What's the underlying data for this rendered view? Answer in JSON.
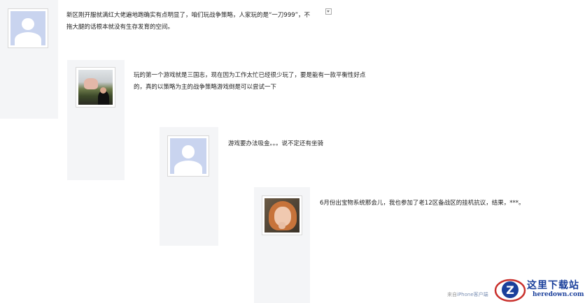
{
  "comments": [
    {
      "avatar": "default-avatar",
      "lines": [
        "新区刚开服就满红大佬遍地跑确实有点明显了，咱们玩战争策略，人家玩的是“一刀999”，不",
        "拖大腿的话根本就没有生存发育的空间。"
      ]
    },
    {
      "avatar": "photo-avatar",
      "lines": [
        "玩的第一个游戏就是三国志，现在因为工作太忙已经很少玩了，要是能有一款平衡性好点",
        "的，真的以策略为主的战争策略游戏倒是可以尝试一下"
      ]
    },
    {
      "avatar": "default-avatar",
      "lines": [
        "游戏要办法吸金。。。说不定还有坐骑"
      ]
    },
    {
      "avatar": "photo-avatar",
      "lines": [
        "6月份出宝物系统那会儿，我也参加了老12区备战区的挂机抗议，结果，***。"
      ]
    }
  ],
  "source": {
    "prefix": "来自",
    "client": "iPhone客户端"
  },
  "watermark": {
    "cn": "这里下载站",
    "en": "heredown.com"
  }
}
